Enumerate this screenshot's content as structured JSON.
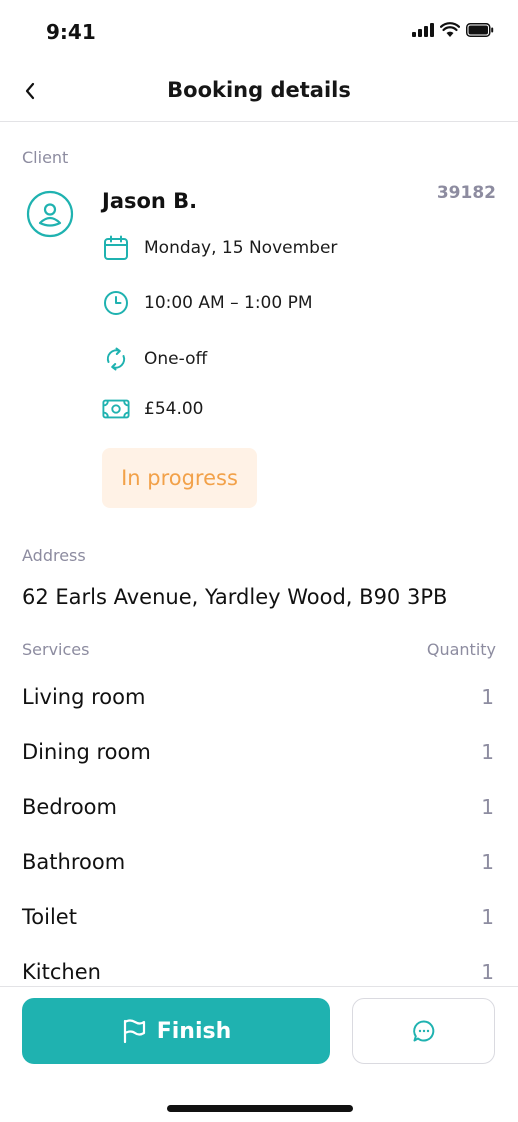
{
  "status_bar": {
    "time": "9:41"
  },
  "header": {
    "title": "Booking details",
    "back_icon": "chevron-left-icon"
  },
  "client": {
    "section_label": "Client",
    "name": "Jason B.",
    "booking_id": "39182",
    "date": "Monday, 15 November",
    "time_range": "10:00 AM – 1:00 PM",
    "frequency": "One-off",
    "price": "£54.00",
    "status": "In progress"
  },
  "address": {
    "section_label": "Address",
    "value": "62 Earls Avenue, Yardley Wood, B90 3PB"
  },
  "services": {
    "label": "Services",
    "quantity_label": "Quantity",
    "items": [
      {
        "name": "Living room",
        "quantity": "1"
      },
      {
        "name": "Dining room",
        "quantity": "1"
      },
      {
        "name": "Bedroom",
        "quantity": "1"
      },
      {
        "name": "Bathroom",
        "quantity": "1"
      },
      {
        "name": "Toilet",
        "quantity": "1"
      },
      {
        "name": "Kitchen",
        "quantity": "1"
      }
    ]
  },
  "actions": {
    "finish_label": "Finish",
    "finish_icon": "flag-icon",
    "chat_icon": "chat-bubble-icon"
  },
  "colors": {
    "accent": "#1fb2b0",
    "status_text": "#f2a149",
    "status_bg": "#fff2e6",
    "muted": "#8d8ca0"
  }
}
